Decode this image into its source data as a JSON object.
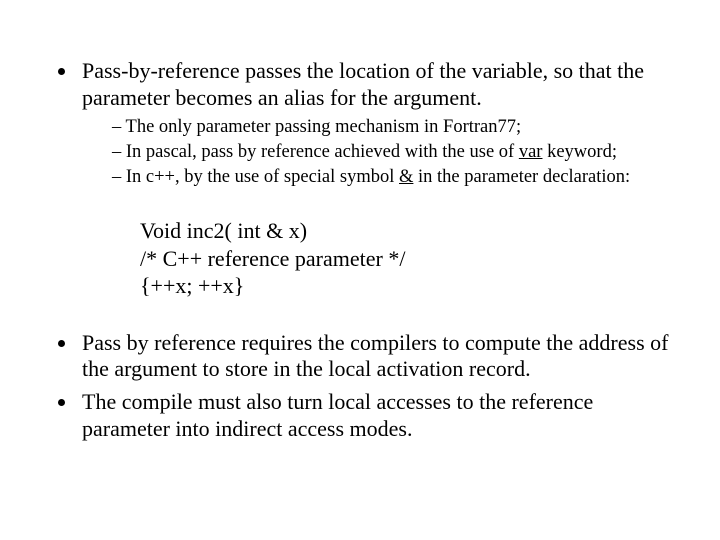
{
  "bullets": {
    "b1_a": "Pass-by-reference passes the location of the variable, so that the parameter becomes an alias for the argument.",
    "sub1": "The only parameter passing mechanism in Fortran77;",
    "sub2_a": "In pascal, pass by reference achieved with the use of ",
    "sub2_u": "var",
    "sub2_b": " keyword;",
    "sub3_a": "In c++, by the use of special symbol ",
    "sub3_u": "&",
    "sub3_b": " in the parameter declaration:",
    "b3_a": "Pass by reference requires the compilers to compute the address of the argument to store in the local activation record.",
    "b4_a": "The compile must also turn local accesses to the reference parameter into indirect access modes."
  },
  "code": {
    "l1": "Void inc2( int & x)",
    "l2": "/* C++ reference parameter */",
    "l3": "{++x; ++x}"
  }
}
